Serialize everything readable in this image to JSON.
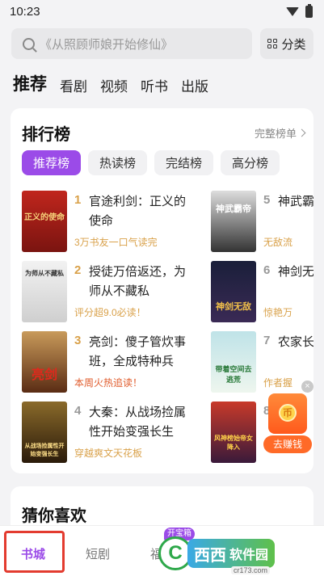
{
  "status": {
    "time": "10:23"
  },
  "search": {
    "placeholder": "《从照顾师娘开始修仙》",
    "category_label": "分类"
  },
  "top_tabs": [
    "推荐",
    "看剧",
    "视频",
    "听书",
    "出版"
  ],
  "ranking": {
    "title": "排行榜",
    "full_list": "完整榜单",
    "tabs": [
      "推荐榜",
      "热读榜",
      "完结榜",
      "高分榜"
    ],
    "left_books": [
      {
        "rank": "1",
        "title": "官途利剑：正义的使命",
        "tag": "3万书友一口气读完",
        "cover_text": "正义的使命"
      },
      {
        "rank": "2",
        "title": "授徒万倍返还，为师从不藏私",
        "tag": "评分超9.0必读！",
        "cover_text": "为师从不藏私"
      },
      {
        "rank": "3",
        "title": "亮剑：傻子管炊事班，全成特种兵",
        "tag": "本周火热追读！",
        "cover_text": "亮剑"
      },
      {
        "rank": "4",
        "title": "大秦：从战场捡属性开始变强长生",
        "tag": "穿越爽文天花板",
        "cover_text": "从战场捡属性开始变强长生"
      }
    ],
    "right_books": [
      {
        "rank": "5",
        "title": "神武霸",
        "tag": "无敌流",
        "cover_text": "神武霸帝"
      },
      {
        "rank": "6",
        "title": "神剑无",
        "tag": "惊艳万",
        "cover_text": "神剑无敌"
      },
      {
        "rank": "7",
        "title": "农家长间去逆",
        "tag": "作者握",
        "cover_text": "带着空间去逃荒"
      },
      {
        "rank": "8",
        "title": "",
        "tag": "",
        "cover_text": "风神榜始帝女降入"
      }
    ]
  },
  "earn": {
    "label": "去赚钱",
    "close": "×"
  },
  "guess": {
    "title": "猜你喜欢"
  },
  "bottom_nav": {
    "items": [
      "书城",
      "短剧",
      "福"
    ],
    "badge": "开宝箱"
  },
  "watermark": {
    "logo": "C",
    "text": "西西",
    "soft": "软件园",
    "url": "cr173.com"
  }
}
